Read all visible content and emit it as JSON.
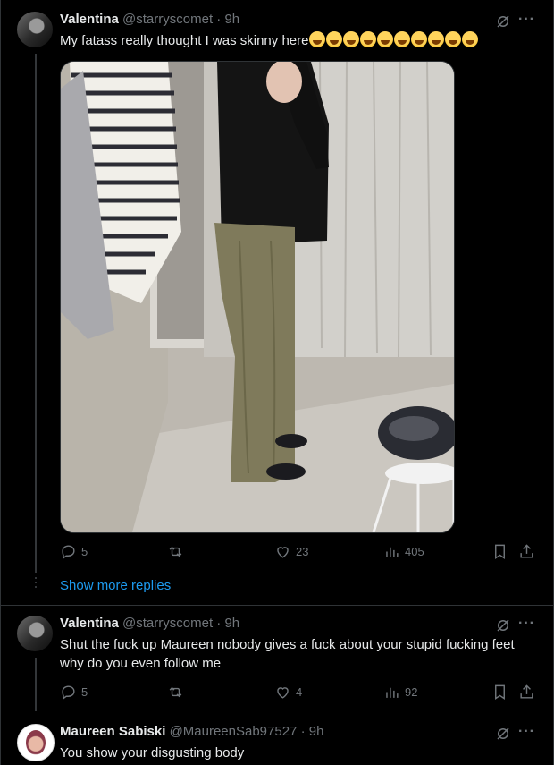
{
  "tweets": [
    {
      "name": "Valentina",
      "handle": "@starryscomet",
      "time": "9h",
      "text": "My fatass really thought I was skinny here",
      "emoji_count": 10,
      "replies": "5",
      "retweets": "",
      "likes": "23",
      "views": "405"
    },
    {
      "name": "Valentina",
      "handle": "@starryscomet",
      "time": "9h",
      "text": "Shut the fuck up Maureen nobody gives a fuck about your stupid fucking feet why do you even follow me",
      "replies": "5",
      "retweets": "",
      "likes": "4",
      "views": "92"
    },
    {
      "name": "Maureen Sabiski",
      "handle": "@MaureenSab97527",
      "time": "9h",
      "text": "You show your disgusting body"
    }
  ],
  "show_more_replies": "Show more replies",
  "sep": " · ",
  "more_label": "···",
  "icons": [
    "reply-icon",
    "retweet-icon",
    "like-icon",
    "views-icon",
    "bookmark-icon",
    "share-icon",
    "grok-icon",
    "more-icon"
  ],
  "colors": {
    "background": "#000000",
    "text": "#e7e9ea",
    "muted": "#71767b",
    "link": "#1d9bf0",
    "border": "#2f3336"
  }
}
